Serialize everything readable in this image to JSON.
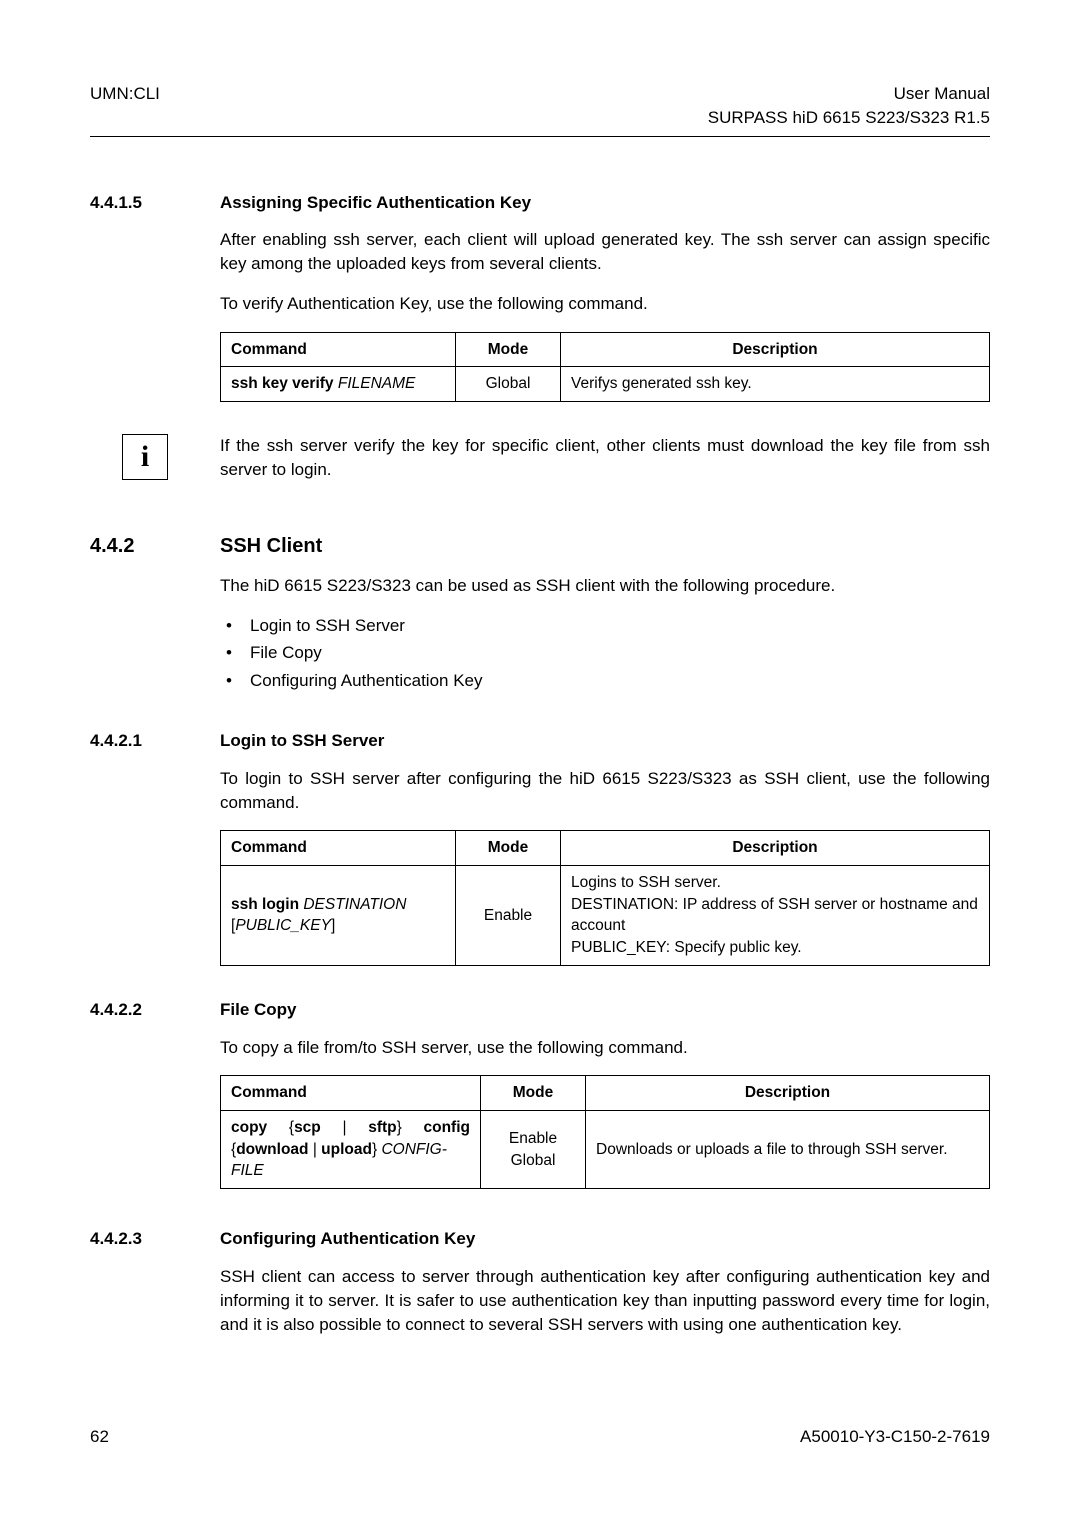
{
  "header": {
    "left": "UMN:CLI",
    "right_top": "User Manual",
    "right_sub": "SURPASS hiD 6615 S223/S323 R1.5"
  },
  "s4415": {
    "num": "4.4.1.5",
    "title": "Assigning Specific Authentication Key",
    "para1": "After enabling ssh server, each client will upload generated key. The ssh server can assign specific key among the uploaded keys from several clients.",
    "para2": "To verify Authentication Key, use the following command.",
    "table": {
      "h_cmd": "Command",
      "h_mode": "Mode",
      "h_desc": "Description",
      "cmd_b": "ssh key verify",
      "cmd_i": " FILENAME",
      "mode": "Global",
      "desc": "Verifys generated ssh key."
    },
    "note_icon": "i",
    "note": "If the ssh server verify the key for specific client, other clients must download the key file from ssh server to login."
  },
  "s442": {
    "num": "4.4.2",
    "title": "SSH Client",
    "para1": "The hiD 6615 S223/S323 can be used as SSH client with the following procedure.",
    "bullets": [
      "Login to SSH Server",
      "File Copy",
      "Configuring Authentication Key"
    ]
  },
  "s4421": {
    "num": "4.4.2.1",
    "title": "Login to SSH Server",
    "para1": "To login to SSH server after configuring the hiD 6615 S223/S323 as SSH client, use the following command.",
    "table": {
      "h_cmd": "Command",
      "h_mode": "Mode",
      "h_desc": "Description",
      "cmd_b1": "ssh login",
      "cmd_i1": " DESTINATION",
      "cmd_i2": "PUBLIC_KEY",
      "mode": "Enable",
      "desc1": "Logins to SSH server.",
      "desc2": "DESTINATION: IP address of SSH server or hostname and account",
      "desc3": "PUBLIC_KEY: Specify public key."
    }
  },
  "s4422": {
    "num": "4.4.2.2",
    "title": "File Copy",
    "para1": "To copy a file from/to SSH server, use the following command.",
    "table": {
      "h_cmd": "Command",
      "h_mode": "Mode",
      "h_desc": "Description",
      "cmd_line1_b1": "copy",
      "cmd_line1_p1": " {",
      "cmd_line1_b2": "scp",
      "cmd_line1_p2": " | ",
      "cmd_line1_b3": "sftp",
      "cmd_line1_p3": "} ",
      "cmd_line1_b4": "config",
      "cmd_line2_p1": "{",
      "cmd_line2_b1": "download",
      "cmd_line2_p2": " | ",
      "cmd_line2_b2": "upload",
      "cmd_line2_p3": "} ",
      "cmd_line2_i1": "CONFIG-FILE",
      "mode1": "Enable",
      "mode2": "Global",
      "desc": "Downloads or uploads a file to through SSH server."
    }
  },
  "s4423": {
    "num": "4.4.2.3",
    "title": "Configuring Authentication Key",
    "para1": "SSH client can access to server through authentication key after configuring authentication key and informing it to server. It is safer to use authentication key than inputting password every time for login, and it is also possible to connect to several SSH servers with using one authentication key."
  },
  "footer": {
    "page": "62",
    "doc": "A50010-Y3-C150-2-7619"
  }
}
